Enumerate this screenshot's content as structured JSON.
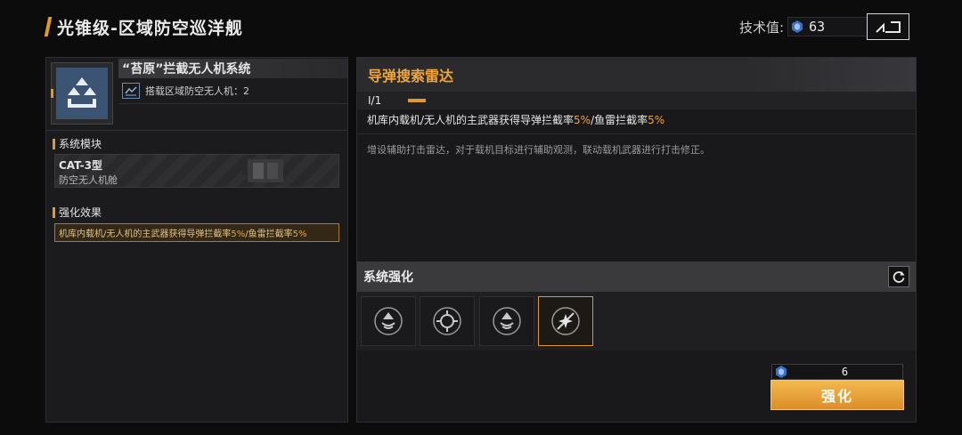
{
  "header": {
    "title": "光锥级-区域防空巡洋舰",
    "tech_label": "技术值:",
    "tech_value": "63",
    "back_icon": "back-arrow-icon"
  },
  "left": {
    "system_name": "“苔原”拦截无人机系统",
    "carry_text": "搭载区域防空无人机：2",
    "module_section": "系统模块",
    "module_name": "CAT-3型",
    "module_type": "防空无人机舱",
    "effect_section": "强化效果",
    "effect_parts": {
      "a": "机库内载机/无人机的主武器获得导弹拦截率",
      "b": "5%",
      "c": "/鱼雷拦截率",
      "d": "5%"
    }
  },
  "right": {
    "radar_title": "导弹搜索雷达",
    "level": "I/1",
    "effect_parts": {
      "a": "机库内载机/无人机的主武器获得导弹拦截率",
      "b": "5%",
      "c": "/鱼雷拦截率",
      "d": "5%"
    },
    "description": "增设辅助打击雷达，对于载机目标进行辅助观测，联动载机武器进行打击修正。",
    "enhance_section": "系统强化",
    "slots": [
      "radar-up-icon",
      "crosshair-icon",
      "radar-up-icon",
      "burst-icon"
    ],
    "cost": "6",
    "enhance_button": "强化"
  },
  "colors": {
    "accent": "#e09a2b",
    "highlight": "#f0a53b",
    "icon_blue": "#3b5474"
  }
}
